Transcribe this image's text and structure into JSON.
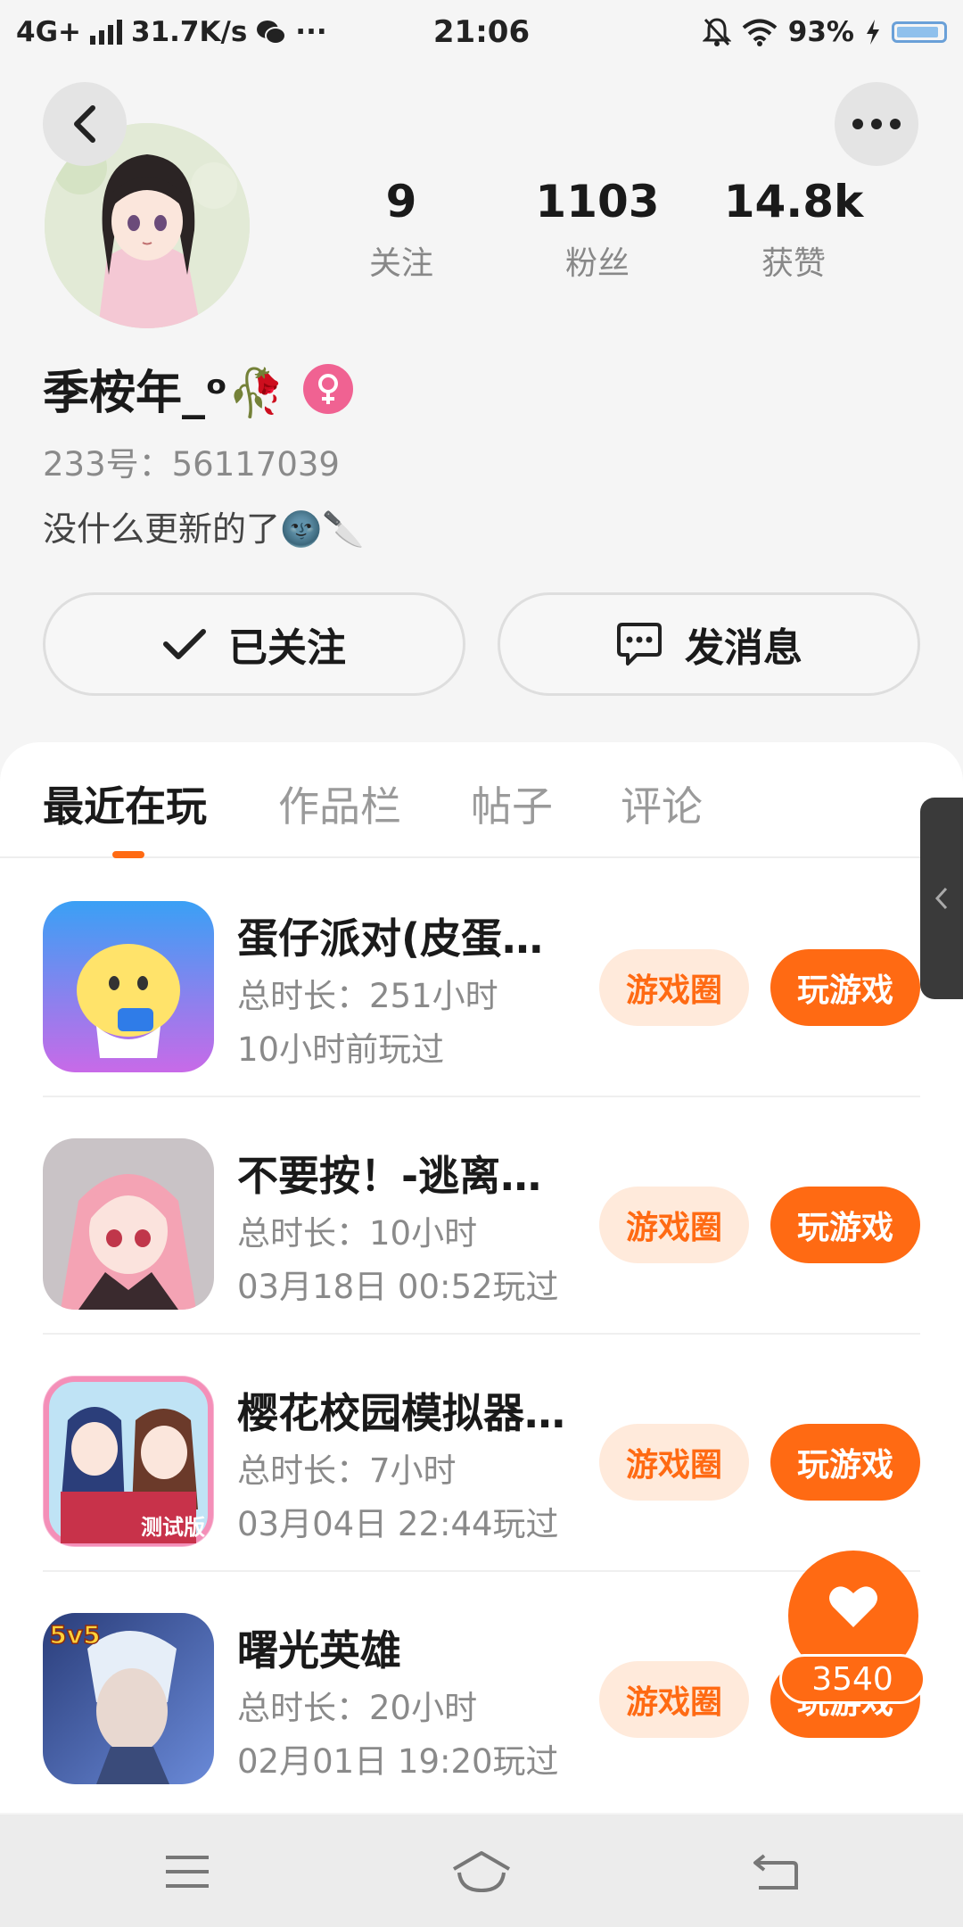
{
  "status_bar": {
    "network": "4G+",
    "speed": "31.7K/s",
    "more": "···",
    "time": "21:06",
    "battery": "93%"
  },
  "profile": {
    "stats": [
      {
        "value": "9",
        "label": "关注"
      },
      {
        "value": "1103",
        "label": "粉丝"
      },
      {
        "value": "14.8k",
        "label": "获赞"
      }
    ],
    "username": "季桉年_ᵒ🥀",
    "user_id": "233号：56117039",
    "bio": "没什么更新的了🌚🔪",
    "follow_label": "已关注",
    "message_label": "发消息"
  },
  "tabs": [
    {
      "label": "最近在玩",
      "active": true
    },
    {
      "label": "作品栏",
      "active": false
    },
    {
      "label": "帖子",
      "active": false
    },
    {
      "label": "评论",
      "active": false
    }
  ],
  "games": [
    {
      "title": "蛋仔派对(皮蛋…",
      "playtime": "总时长：251小时",
      "last_played": "10小时前玩过",
      "circle_label": "游戏圈",
      "play_label": "玩游戏"
    },
    {
      "title": "不要按！-逃离…",
      "playtime": "总时长：10小时",
      "last_played": "03月18日 00:52玩过",
      "circle_label": "游戏圈",
      "play_label": "玩游戏"
    },
    {
      "title": "樱花校园模拟器…",
      "playtime": "总时长：7小时",
      "last_played": "03月04日 22:44玩过",
      "circle_label": "游戏圈",
      "play_label": "玩游戏"
    },
    {
      "title": "曙光英雄",
      "playtime": "总时长：20小时",
      "last_played": "02月01日 19:20玩过",
      "circle_label": "游戏圈",
      "play_label": "玩游戏"
    }
  ],
  "game_icon_texts": {
    "game3_badge": "测试版",
    "game4_badge": "5v5"
  },
  "like": {
    "count": "3540"
  },
  "colors": {
    "accent": "#ff6a13",
    "accent_light": "#ffeadb",
    "gender_female": "#f06292"
  }
}
